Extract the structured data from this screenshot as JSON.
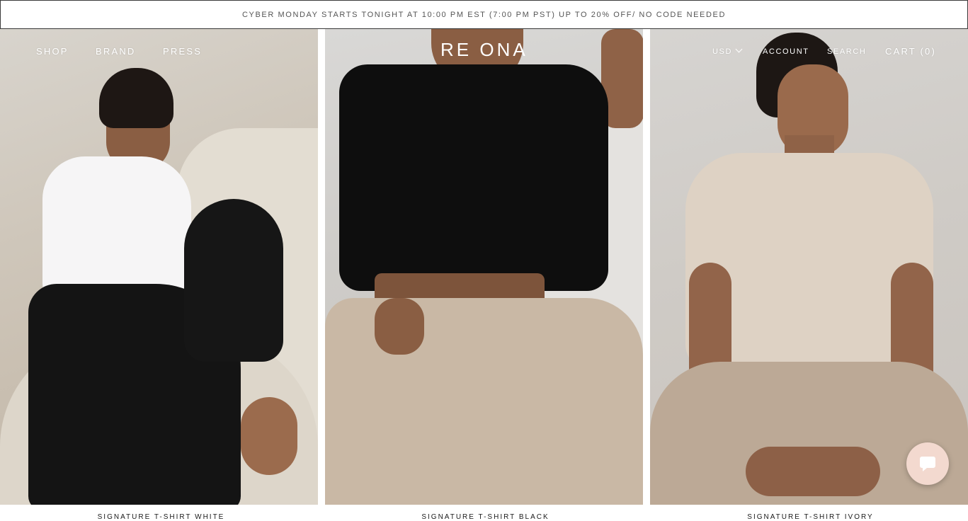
{
  "announcement": "CYBER MONDAY STARTS TONIGHT AT 10:00 PM EST (7:00 PM PST) UP TO 20% OFF/ NO CODE NEEDED",
  "nav": {
    "shop": "SHOP",
    "brand": "BRAND",
    "press": "PRESS",
    "logo": "RE ONA",
    "currency": "USD",
    "account": "ACCOUNT",
    "search": "SEARCH",
    "cart": "CART (0)"
  },
  "products": [
    {
      "name": "SIGNATURE T-SHIRT WHITE"
    },
    {
      "name": "SIGNATURE T-SHIRT BLACK"
    },
    {
      "name": "SIGNATURE T-SHIRT IVORY"
    }
  ],
  "icons": {
    "currency_dropdown": "chevron-down-icon",
    "chat": "chat-bubble-icon"
  },
  "colors": {
    "text_dark": "#1a1a1a",
    "nav_text": "#ffffff",
    "chat_bg": "#f3d9cf"
  }
}
